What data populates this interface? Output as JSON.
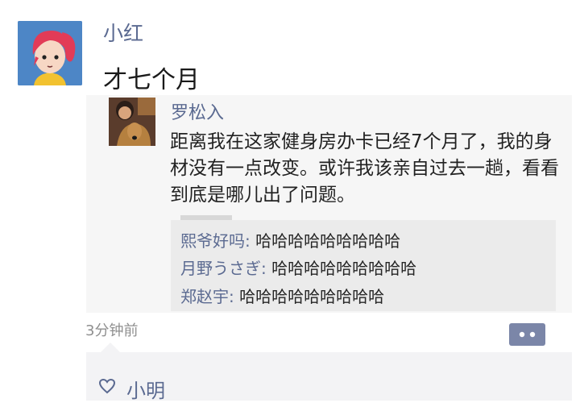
{
  "post": {
    "username": "小红",
    "text": "才七个月",
    "time": "3分钟前"
  },
  "shared": {
    "name": "罗松入",
    "text": "距离我在这家健身房办卡已经7个月了，我的身材没有一点改变。或许我该亲自过去一趟，看看到底是哪儿出了问题。",
    "comments": [
      {
        "name": "熙爷好吗:",
        "text": " 哈哈哈哈哈哈哈哈哈"
      },
      {
        "name": "月野うさぎ:",
        "text": " 哈哈哈哈哈哈哈哈哈"
      },
      {
        "name": "郑赵宇:",
        "text": " 哈哈哈哈哈哈哈哈哈"
      }
    ]
  },
  "likes": {
    "users": [
      "小明"
    ]
  },
  "icons": {
    "avatar": "cartoon-girl-avatar",
    "comment_button": "more-dots-icon",
    "like": "heart-icon"
  },
  "colors": {
    "name_link": "#5b6a91",
    "avatar_bg": "#4d86c6",
    "comment_button": "#7b86a8"
  }
}
